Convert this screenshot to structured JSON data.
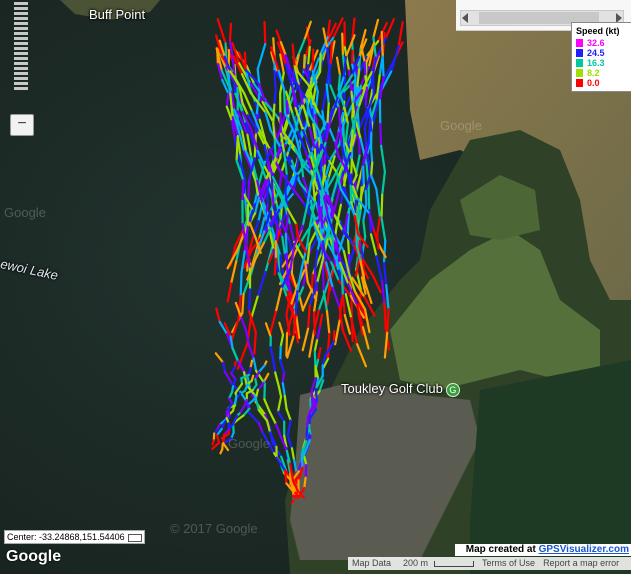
{
  "map": {
    "labels": {
      "buff_point": "Buff Point",
      "lake": "ewoi Lake",
      "golf_club": "Toukley Golf Club"
    },
    "watermarks": [
      "Google",
      "Google",
      "Google",
      "© 2017 Google"
    ],
    "golf_marker_glyph": "G"
  },
  "zoom": {
    "zoom_out_label": "−"
  },
  "legend": {
    "title": "Speed (kt)",
    "items": [
      {
        "label": "32.6",
        "color": "#ff00ff"
      },
      {
        "label": "24.5",
        "color": "#2020ff"
      },
      {
        "label": "16.3",
        "color": "#00c8a0"
      },
      {
        "label": "8.2",
        "color": "#a0e000"
      },
      {
        "label": "0.0",
        "color": "#ff0000"
      }
    ]
  },
  "status": {
    "center": "Center: -33.24868,151.54406",
    "google": "Google",
    "credit_prefix": "Map created at ",
    "credit_link": "GPSVisualizer.com",
    "map_data": "Map Data",
    "scale": "200 m",
    "terms": "Terms of Use",
    "report": "Report a map error"
  },
  "colors": {
    "water": "#1d2c27",
    "land": "#3a4a30",
    "track_palette": [
      "#ff0000",
      "#ffa000",
      "#a0e000",
      "#00c8a0",
      "#00b0ff",
      "#2020ff",
      "#8000ff"
    ]
  }
}
